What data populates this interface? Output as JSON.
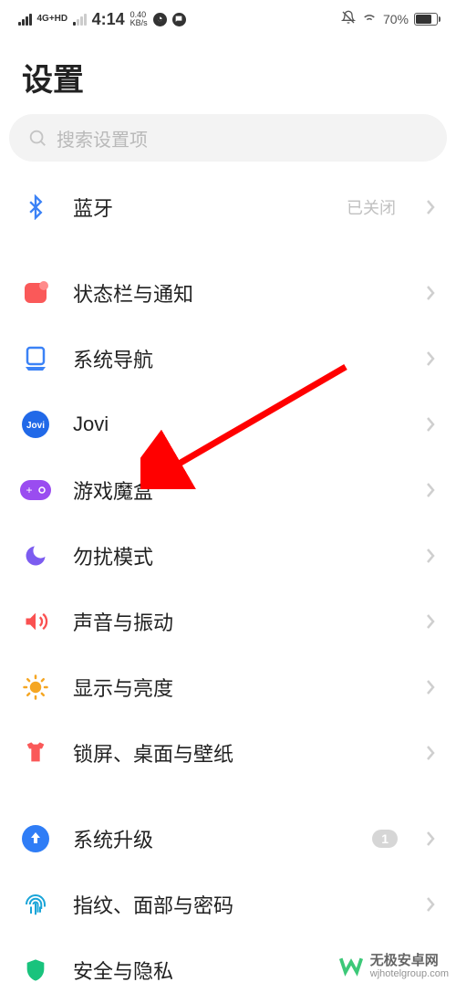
{
  "statusbar": {
    "network": "4G+HD",
    "time": "4:14",
    "speed_top": "0.40",
    "speed_bottom": "KB/s",
    "battery_pct": "70%"
  },
  "page_title": "设置",
  "search": {
    "placeholder": "搜索设置项"
  },
  "items": {
    "bluetooth": {
      "label": "蓝牙",
      "value": "已关闭"
    },
    "statusbar_notif": {
      "label": "状态栏与通知"
    },
    "sys_nav": {
      "label": "系统导航"
    },
    "jovi": {
      "label": "Jovi"
    },
    "gamebox": {
      "label": "游戏魔盒"
    },
    "dnd": {
      "label": "勿扰模式"
    },
    "sound": {
      "label": "声音与振动"
    },
    "display": {
      "label": "显示与亮度"
    },
    "lockscreen": {
      "label": "锁屏、桌面与壁纸"
    },
    "sys_upgrade": {
      "label": "系统升级",
      "badge": "1"
    },
    "biometrics": {
      "label": "指纹、面部与密码"
    },
    "security": {
      "label": "安全与隐私"
    }
  },
  "watermark": {
    "line1": "无极安卓网",
    "line2": "wjhotelgroup.com"
  }
}
